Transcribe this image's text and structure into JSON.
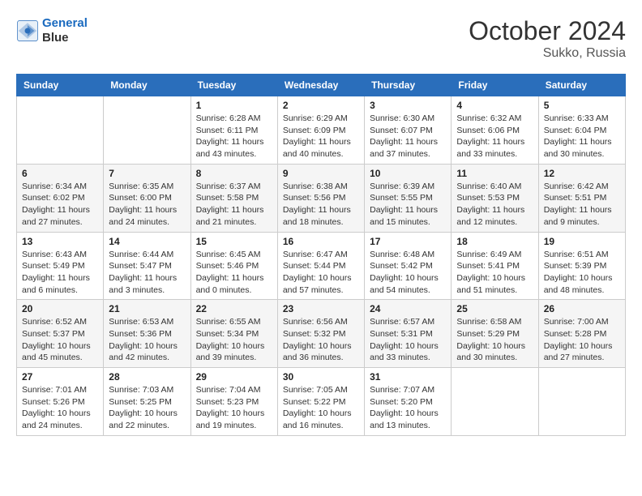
{
  "logo": {
    "line1": "General",
    "line2": "Blue"
  },
  "title": "October 2024",
  "location": "Sukko, Russia",
  "weekdays": [
    "Sunday",
    "Monday",
    "Tuesday",
    "Wednesday",
    "Thursday",
    "Friday",
    "Saturday"
  ],
  "weeks": [
    [
      {
        "day": null,
        "info": null
      },
      {
        "day": null,
        "info": null
      },
      {
        "day": "1",
        "info": "Sunrise: 6:28 AM\nSunset: 6:11 PM\nDaylight: 11 hours\nand 43 minutes."
      },
      {
        "day": "2",
        "info": "Sunrise: 6:29 AM\nSunset: 6:09 PM\nDaylight: 11 hours\nand 40 minutes."
      },
      {
        "day": "3",
        "info": "Sunrise: 6:30 AM\nSunset: 6:07 PM\nDaylight: 11 hours\nand 37 minutes."
      },
      {
        "day": "4",
        "info": "Sunrise: 6:32 AM\nSunset: 6:06 PM\nDaylight: 11 hours\nand 33 minutes."
      },
      {
        "day": "5",
        "info": "Sunrise: 6:33 AM\nSunset: 6:04 PM\nDaylight: 11 hours\nand 30 minutes."
      }
    ],
    [
      {
        "day": "6",
        "info": "Sunrise: 6:34 AM\nSunset: 6:02 PM\nDaylight: 11 hours\nand 27 minutes."
      },
      {
        "day": "7",
        "info": "Sunrise: 6:35 AM\nSunset: 6:00 PM\nDaylight: 11 hours\nand 24 minutes."
      },
      {
        "day": "8",
        "info": "Sunrise: 6:37 AM\nSunset: 5:58 PM\nDaylight: 11 hours\nand 21 minutes."
      },
      {
        "day": "9",
        "info": "Sunrise: 6:38 AM\nSunset: 5:56 PM\nDaylight: 11 hours\nand 18 minutes."
      },
      {
        "day": "10",
        "info": "Sunrise: 6:39 AM\nSunset: 5:55 PM\nDaylight: 11 hours\nand 15 minutes."
      },
      {
        "day": "11",
        "info": "Sunrise: 6:40 AM\nSunset: 5:53 PM\nDaylight: 11 hours\nand 12 minutes."
      },
      {
        "day": "12",
        "info": "Sunrise: 6:42 AM\nSunset: 5:51 PM\nDaylight: 11 hours\nand 9 minutes."
      }
    ],
    [
      {
        "day": "13",
        "info": "Sunrise: 6:43 AM\nSunset: 5:49 PM\nDaylight: 11 hours\nand 6 minutes."
      },
      {
        "day": "14",
        "info": "Sunrise: 6:44 AM\nSunset: 5:47 PM\nDaylight: 11 hours\nand 3 minutes."
      },
      {
        "day": "15",
        "info": "Sunrise: 6:45 AM\nSunset: 5:46 PM\nDaylight: 11 hours\nand 0 minutes."
      },
      {
        "day": "16",
        "info": "Sunrise: 6:47 AM\nSunset: 5:44 PM\nDaylight: 10 hours\nand 57 minutes."
      },
      {
        "day": "17",
        "info": "Sunrise: 6:48 AM\nSunset: 5:42 PM\nDaylight: 10 hours\nand 54 minutes."
      },
      {
        "day": "18",
        "info": "Sunrise: 6:49 AM\nSunset: 5:41 PM\nDaylight: 10 hours\nand 51 minutes."
      },
      {
        "day": "19",
        "info": "Sunrise: 6:51 AM\nSunset: 5:39 PM\nDaylight: 10 hours\nand 48 minutes."
      }
    ],
    [
      {
        "day": "20",
        "info": "Sunrise: 6:52 AM\nSunset: 5:37 PM\nDaylight: 10 hours\nand 45 minutes."
      },
      {
        "day": "21",
        "info": "Sunrise: 6:53 AM\nSunset: 5:36 PM\nDaylight: 10 hours\nand 42 minutes."
      },
      {
        "day": "22",
        "info": "Sunrise: 6:55 AM\nSunset: 5:34 PM\nDaylight: 10 hours\nand 39 minutes."
      },
      {
        "day": "23",
        "info": "Sunrise: 6:56 AM\nSunset: 5:32 PM\nDaylight: 10 hours\nand 36 minutes."
      },
      {
        "day": "24",
        "info": "Sunrise: 6:57 AM\nSunset: 5:31 PM\nDaylight: 10 hours\nand 33 minutes."
      },
      {
        "day": "25",
        "info": "Sunrise: 6:58 AM\nSunset: 5:29 PM\nDaylight: 10 hours\nand 30 minutes."
      },
      {
        "day": "26",
        "info": "Sunrise: 7:00 AM\nSunset: 5:28 PM\nDaylight: 10 hours\nand 27 minutes."
      }
    ],
    [
      {
        "day": "27",
        "info": "Sunrise: 7:01 AM\nSunset: 5:26 PM\nDaylight: 10 hours\nand 24 minutes."
      },
      {
        "day": "28",
        "info": "Sunrise: 7:03 AM\nSunset: 5:25 PM\nDaylight: 10 hours\nand 22 minutes."
      },
      {
        "day": "29",
        "info": "Sunrise: 7:04 AM\nSunset: 5:23 PM\nDaylight: 10 hours\nand 19 minutes."
      },
      {
        "day": "30",
        "info": "Sunrise: 7:05 AM\nSunset: 5:22 PM\nDaylight: 10 hours\nand 16 minutes."
      },
      {
        "day": "31",
        "info": "Sunrise: 7:07 AM\nSunset: 5:20 PM\nDaylight: 10 hours\nand 13 minutes."
      },
      {
        "day": null,
        "info": null
      },
      {
        "day": null,
        "info": null
      }
    ]
  ]
}
